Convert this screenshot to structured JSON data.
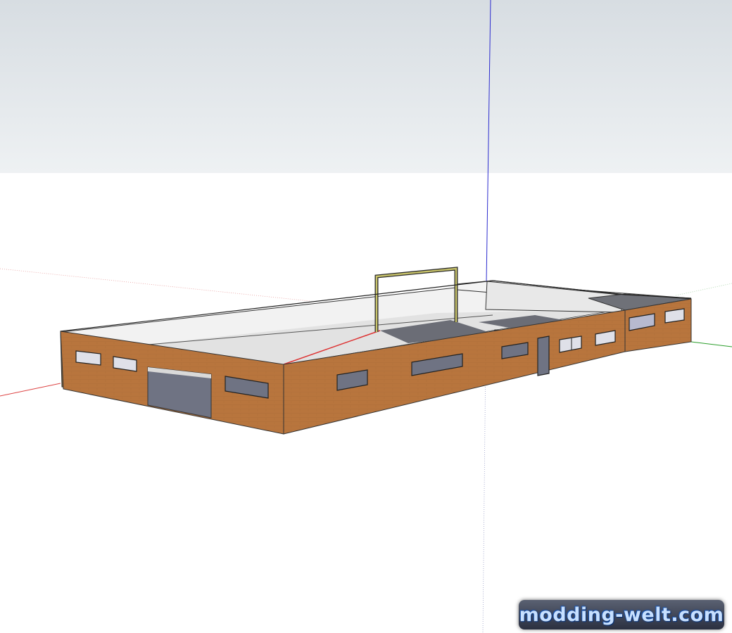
{
  "scene": {
    "type": "3d-model-viewport",
    "subject": "single-storey-hall",
    "sky_color": "#dfe4e8",
    "ground_color": "#ffffff",
    "wall_color": "#b8753d",
    "opening_color": "#6f7383",
    "axis_colors": {
      "red": "#d44",
      "green": "#2a9d2a",
      "blue": "#2c2ccf"
    }
  },
  "watermark": {
    "text": "modding-welt.com"
  }
}
